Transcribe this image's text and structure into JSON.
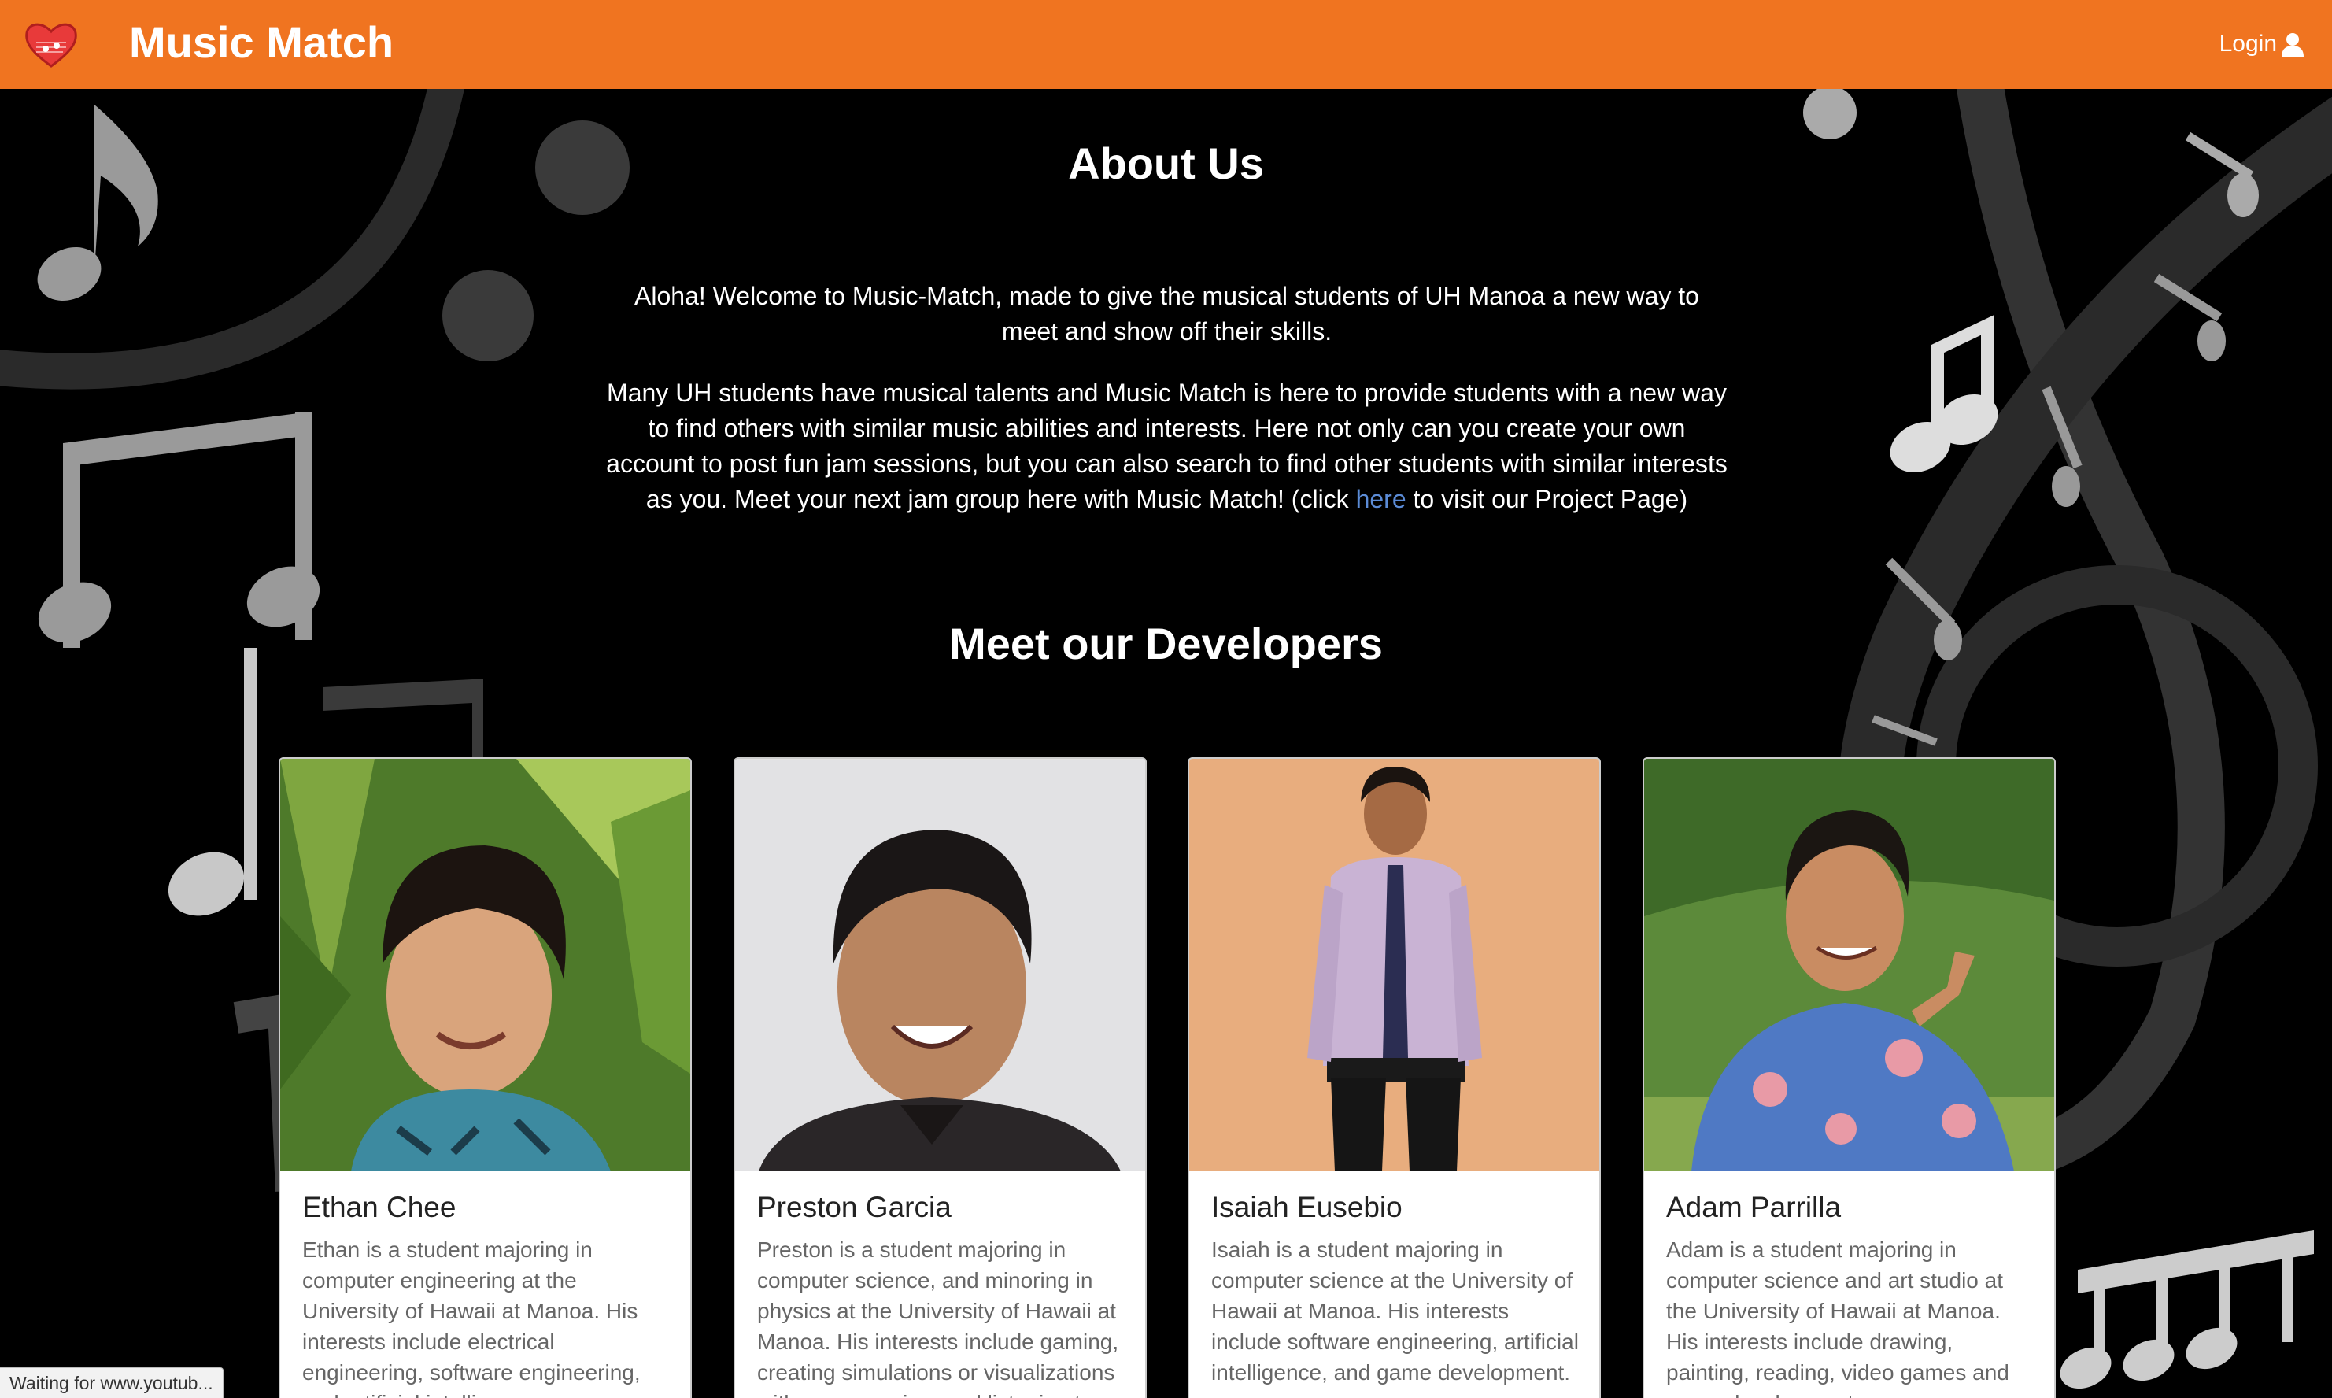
{
  "navbar": {
    "brand": "Music Match",
    "login_label": "Login",
    "logo_icon": "heart-music-icon",
    "user_icon": "user-icon",
    "color": "#f07420"
  },
  "about": {
    "title": "About Us",
    "paragraph1": "Aloha! Welcome to Music-Match, made to give the musical students of UH Manoa a new way to meet and show off their skills.",
    "paragraph2_before_link": "Many UH students have musical talents and Music Match is here to provide students with a new way to find others with similar music abilities and interests. Here not only can you create your own account to post fun jam sessions, but you can also search to find other students with similar interests as you. Meet your next jam group here with Music Match! (click ",
    "paragraph2_link": "here",
    "paragraph2_after_link": " to visit our Project Page)"
  },
  "developers": {
    "title": "Meet our Developers",
    "cards": [
      {
        "name": "Ethan Chee",
        "description": "Ethan is a student majoring in computer engineering at the University of Hawaii at Manoa. His interests include electrical engineering, software engineering, and artificial intelligence."
      },
      {
        "name": "Preston Garcia",
        "description": "Preston is a student majoring in computer science, and minoring in physics at the University of Hawaii at Manoa. His interests include gaming, creating simulations or visualizations with programming, and listening to music."
      },
      {
        "name": "Isaiah Eusebio",
        "description": "Isaiah is a student majoring in computer science at the University of Hawaii at Manoa. His interests include software engineering, artificial intelligence, and game development."
      },
      {
        "name": "Adam Parrilla",
        "description": "Adam is a student majoring in computer science and art studio at the University of Hawaii at Manoa. His interests include drawing, painting, reading, video games and game development."
      }
    ]
  },
  "status_bar": {
    "text": "Waiting for www.youtub..."
  }
}
